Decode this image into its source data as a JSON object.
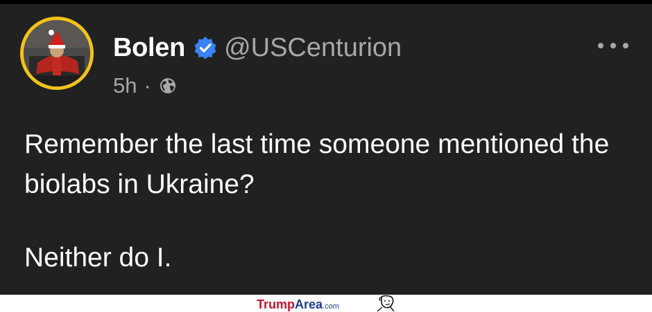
{
  "post": {
    "display_name": "Bolen",
    "handle": "@USCenturion",
    "timestamp": "5h",
    "separator": "·",
    "verified": true,
    "body_lines": [
      "Remember the last time someone mentioned the biolabs in Ukraine?",
      "Neither do I."
    ],
    "icons": {
      "verified": "verified-badge-icon",
      "visibility": "globe-icon",
      "menu": "more-options-icon"
    },
    "colors": {
      "background": "#212122",
      "name": "#ffffff",
      "muted": "#a7a8aa",
      "verified": "#3b82f6",
      "avatar_ring": "#f2c318"
    }
  },
  "watermark": {
    "site_part1": "Trump",
    "site_part2": "Area",
    "site_tld": ".com"
  }
}
